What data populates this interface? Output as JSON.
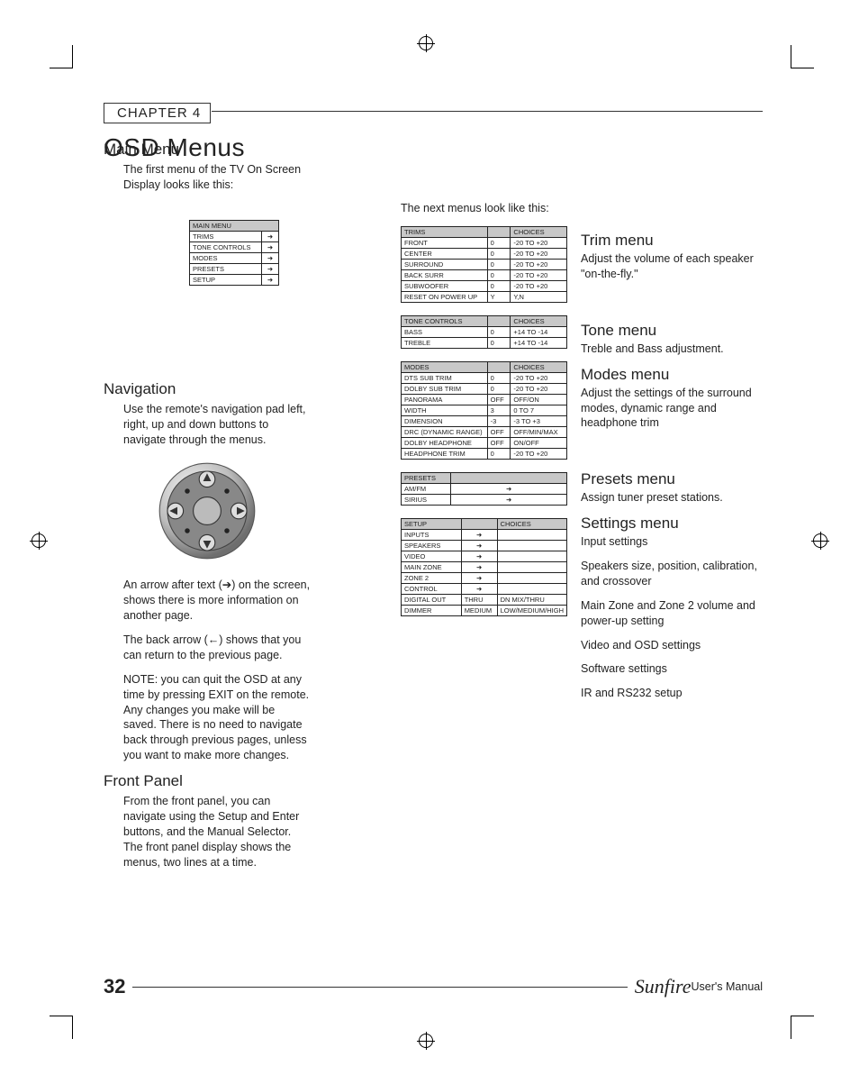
{
  "chapter": "CHAPTER 4",
  "page_title": "OSD Menus",
  "main_menu_heading": "Main Menu",
  "main_menu_text": "The first menu of the TV On Screen Display looks like this:",
  "next_menus_text": "The next menus look like this:",
  "navigation_heading": "Navigation",
  "navigation_text": "Use the remote's navigation pad left, right, up and down buttons to navigate through the menus.",
  "nav_note1": "An arrow after text (➔) on the screen, shows there is more information on another page.",
  "nav_note2": "The back arrow (←) shows that you can return to the previous page.",
  "nav_note3": "NOTE: you can quit the OSD at any time by pressing EXIT on the remote. Any changes you make will be saved. There is no need to navigate back through previous pages, unless you want to make more changes.",
  "front_panel_heading": "Front Panel",
  "front_panel_text": "From the front panel, you can navigate using the Setup and Enter buttons, and the Manual Selector. The front panel display shows the menus, two lines at a time.",
  "main_menu_table": {
    "header": "MAIN MENU",
    "rows": [
      "TRIMS",
      "TONE CONTROLS",
      "MODES",
      "PRESETS",
      "SETUP"
    ]
  },
  "trims_table": {
    "header": "TRIMS",
    "choices": "CHOICES",
    "rows": [
      {
        "n": "FRONT",
        "v": "0",
        "c": "-20 TO +20"
      },
      {
        "n": "CENTER",
        "v": "0",
        "c": "-20 TO +20"
      },
      {
        "n": "SURROUND",
        "v": "0",
        "c": "-20 TO +20"
      },
      {
        "n": "BACK SURR",
        "v": "0",
        "c": "-20 TO +20"
      },
      {
        "n": "SUBWOOFER",
        "v": "0",
        "c": "-20 TO +20"
      },
      {
        "n": "RESET ON POWER UP",
        "v": "Y",
        "c": "Y,N"
      }
    ]
  },
  "tone_table": {
    "header": "TONE CONTROLS",
    "choices": "CHOICES",
    "rows": [
      {
        "n": "BASS",
        "v": "0",
        "c": "+14 TO -14"
      },
      {
        "n": "TREBLE",
        "v": "0",
        "c": "+14 TO -14"
      }
    ]
  },
  "modes_table": {
    "header": "MODES",
    "choices": "CHOICES",
    "rows": [
      {
        "n": "DTS SUB TRIM",
        "v": "0",
        "c": "-20 TO +20"
      },
      {
        "n": "DOLBY SUB TRIM",
        "v": "0",
        "c": "-20 TO +20"
      },
      {
        "n": "PANORAMA",
        "v": "OFF",
        "c": "OFF/ON"
      },
      {
        "n": "WIDTH",
        "v": "3",
        "c": "0 TO 7"
      },
      {
        "n": "DIMENSION",
        "v": "-3",
        "c": "-3 TO +3"
      },
      {
        "n": "DRC (DYNAMIC RANGE)",
        "v": "OFF",
        "c": "OFF/MIN/MAX"
      },
      {
        "n": "DOLBY HEADPHONE",
        "v": "OFF",
        "c": "ON/OFF"
      },
      {
        "n": "HEADPHONE TRIM",
        "v": "0",
        "c": "-20 TO +20"
      }
    ]
  },
  "presets_table": {
    "header": "PRESETS",
    "rows": [
      "AM/FM",
      "SIRIUS"
    ]
  },
  "setup_table": {
    "header": "SETUP",
    "choices": "CHOICES",
    "rows": [
      {
        "n": "INPUTS",
        "arrow": true
      },
      {
        "n": "SPEAKERS",
        "arrow": true
      },
      {
        "n": "VIDEO",
        "arrow": true
      },
      {
        "n": "MAIN ZONE",
        "arrow": true
      },
      {
        "n": "ZONE 2",
        "arrow": true
      },
      {
        "n": "CONTROL",
        "arrow": true
      },
      {
        "n": "DIGITAL OUT",
        "v": "THRU",
        "c": "DN MIX/THRU"
      },
      {
        "n": "DIMMER",
        "v": "MEDIUM",
        "c": "LOW/MEDIUM/HIGH"
      }
    ]
  },
  "trim_menu": {
    "h": "Trim menu",
    "t": "Adjust the volume of each speaker \"on-the-fly.\""
  },
  "tone_menu": {
    "h": "Tone menu",
    "t": "Treble and Bass adjustment."
  },
  "modes_menu": {
    "h": "Modes menu",
    "t": "Adjust the settings of the surround modes, dynamic range and headphone trim"
  },
  "presets_menu": {
    "h": "Presets menu",
    "t": "Assign tuner preset stations."
  },
  "settings_menu": {
    "h": "Settings menu",
    "lines": [
      "Input settings",
      "Speakers size, position, calibration, and crossover",
      "Main Zone and Zone 2 volume and power-up setting",
      "Video and OSD settings",
      "Software settings",
      "IR and RS232 setup"
    ]
  },
  "page_number": "32",
  "brand": "Sunfire",
  "manual_label": " User's Manual",
  "arrow_glyph": "➜"
}
